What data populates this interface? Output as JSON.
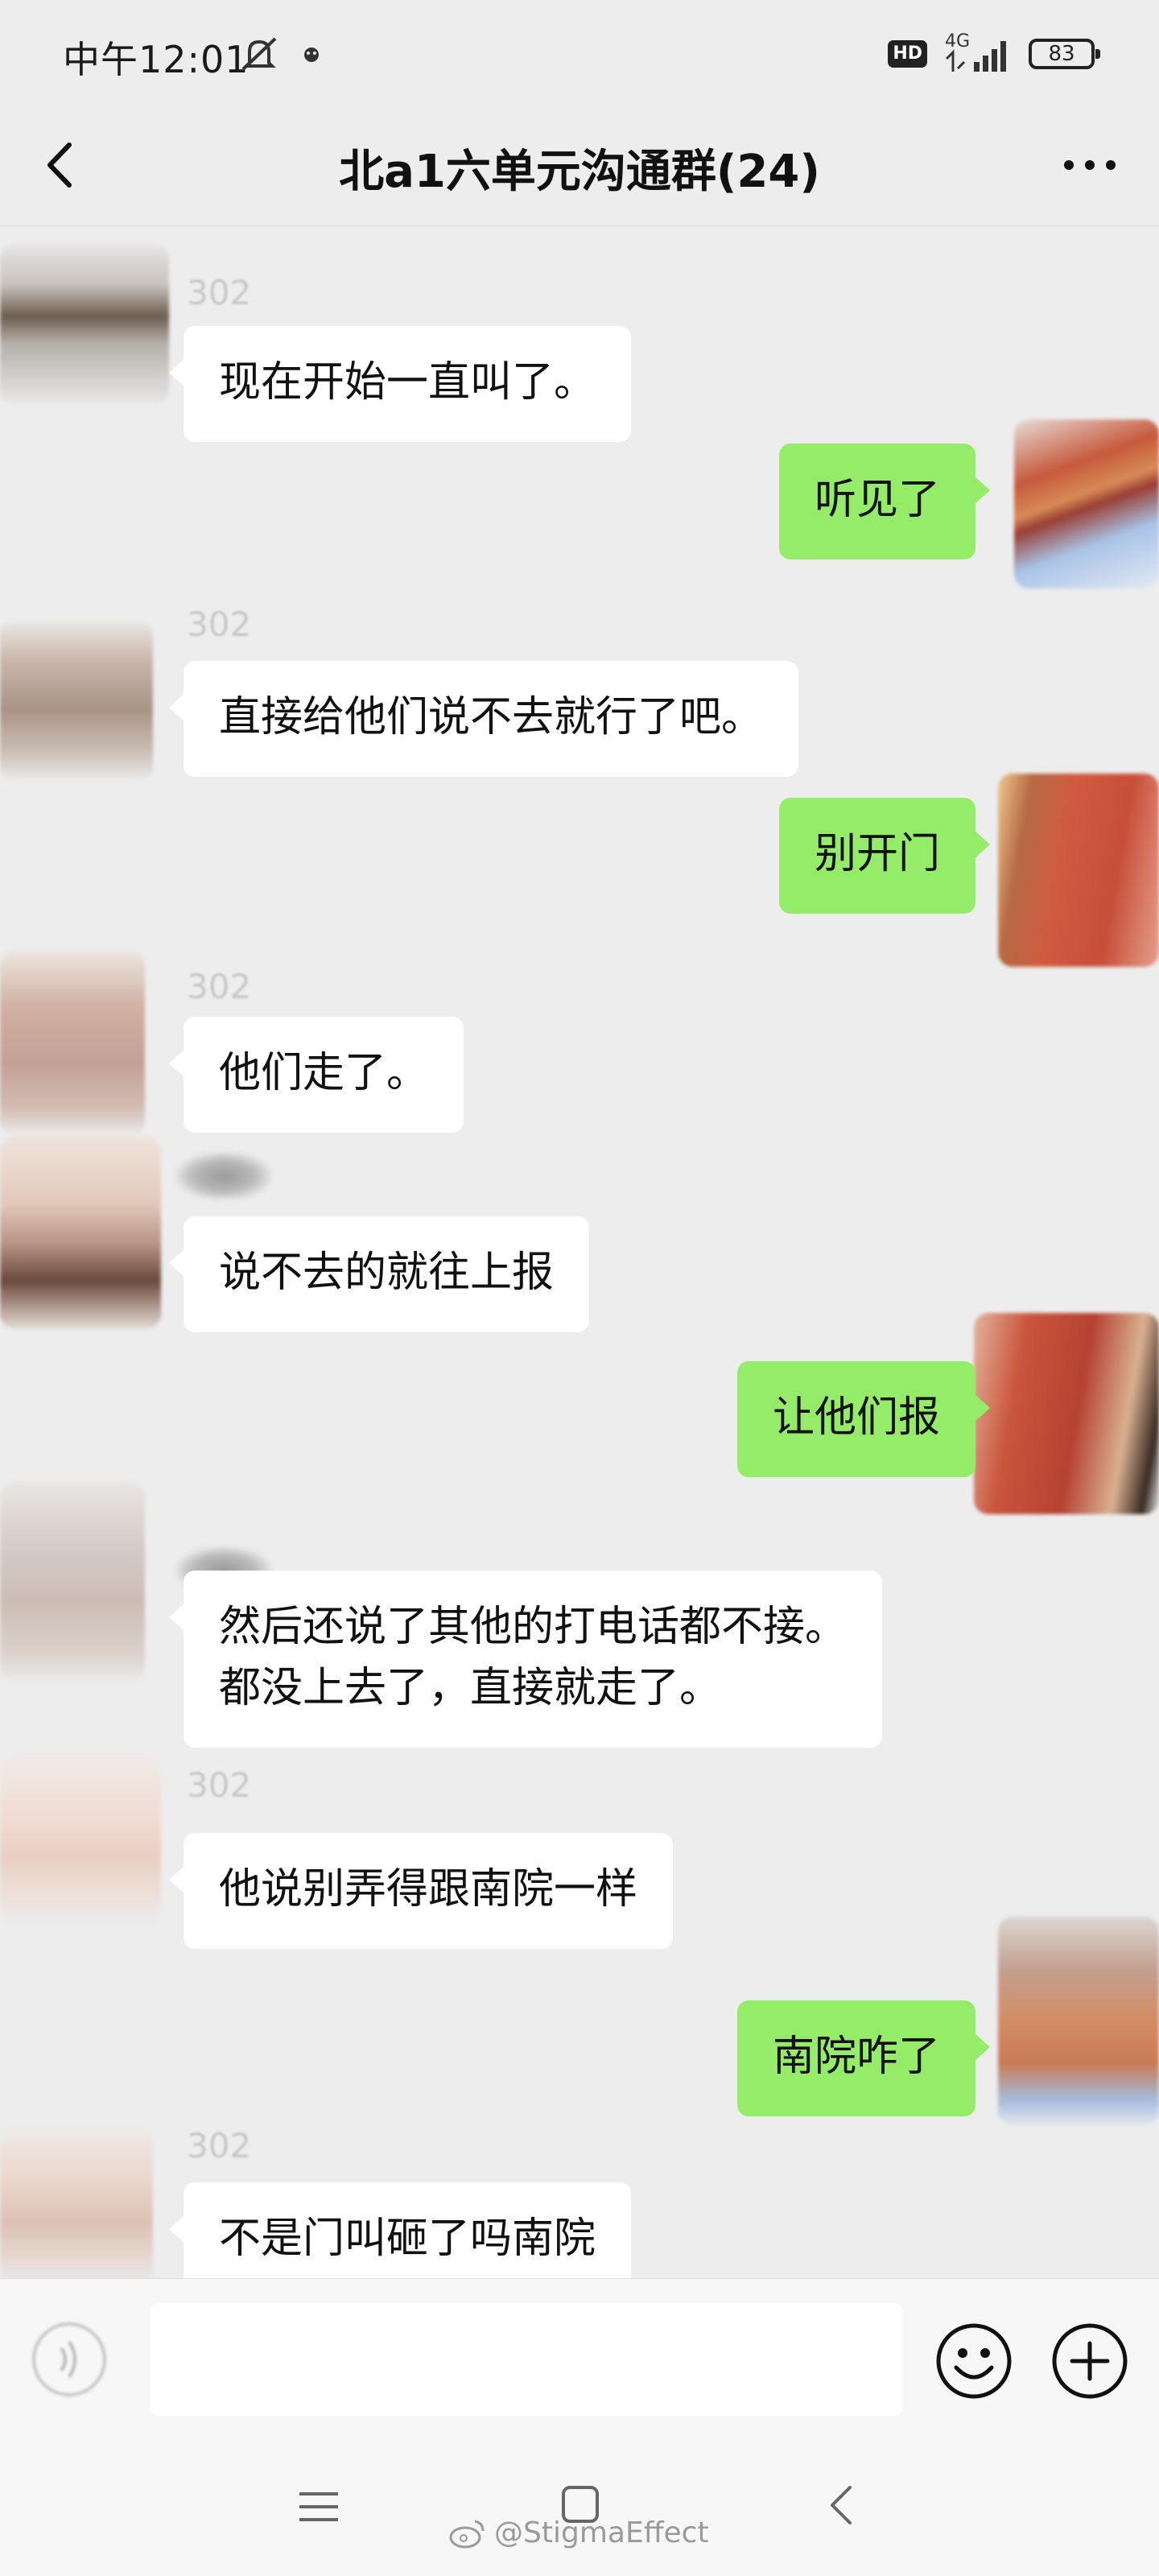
{
  "status_bar": {
    "time": "中午12:01",
    "network": "4G",
    "hd_badge": "HD",
    "battery": "83"
  },
  "header": {
    "title": "北a1六单元沟通群(24)"
  },
  "messages": [
    {
      "side": "in",
      "sender": "302",
      "text": "现在开始一直叫了。"
    },
    {
      "side": "out",
      "text": "听见了"
    },
    {
      "side": "in",
      "sender": "302",
      "text": "直接给他们说不去就行了吧。"
    },
    {
      "side": "out",
      "text": "别开门"
    },
    {
      "side": "in",
      "sender": "302",
      "text": "他们走了。"
    },
    {
      "side": "in",
      "sender": "",
      "text": "说不去的就往上报"
    },
    {
      "side": "out",
      "text": "让他们报"
    },
    {
      "side": "in",
      "sender": "",
      "text": "然后还说了其他的打电话都不接。\n都没上去了，直接就走了。"
    },
    {
      "side": "in",
      "sender": "302",
      "text": "他说别弄得跟南院一样"
    },
    {
      "side": "out",
      "text": "南院咋了"
    },
    {
      "side": "in",
      "sender": "302",
      "text": "不是门叫砸了吗南院"
    }
  ],
  "input_bar": {
    "placeholder": ""
  },
  "watermark": {
    "text": "@StigmaEffect"
  },
  "colors": {
    "background": "#ededed",
    "incoming_bubble": "#ffffff",
    "outgoing_bubble": "#95ec69"
  },
  "icons": {
    "back": "back-chevron-icon",
    "more": "more-dots-icon",
    "voice": "voice-icon",
    "emoji": "emoji-icon",
    "plus": "plus-icon"
  }
}
